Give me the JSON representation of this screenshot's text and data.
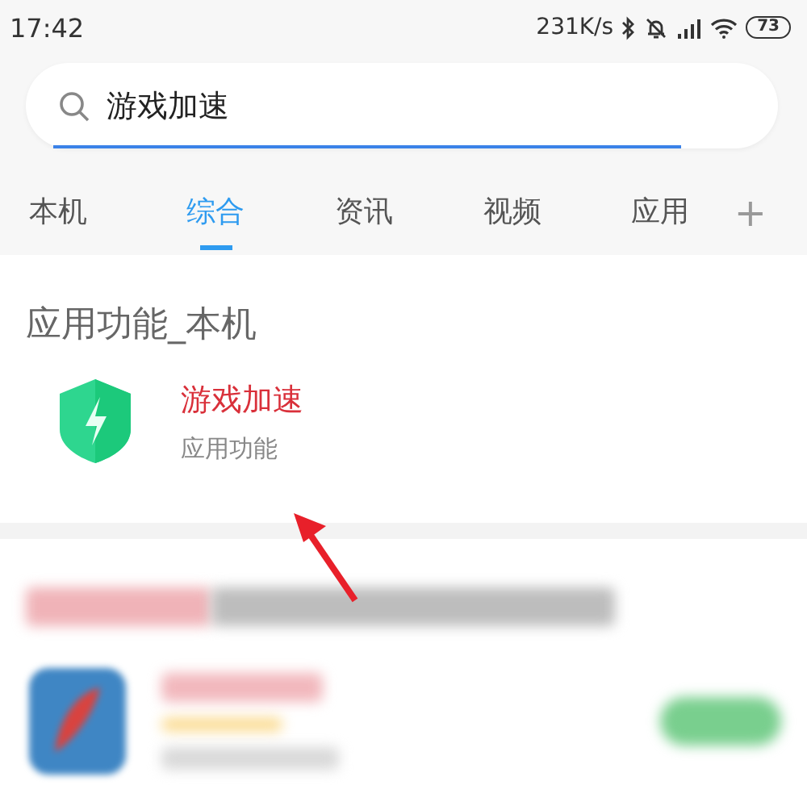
{
  "status_bar": {
    "time": "17:42",
    "network_speed": "231K/s",
    "battery": "73"
  },
  "search": {
    "value": "游戏加速"
  },
  "tabs": [
    {
      "label": "本机",
      "selected": false
    },
    {
      "label": "综合",
      "selected": true
    },
    {
      "label": "资讯",
      "selected": false
    },
    {
      "label": "视频",
      "selected": false
    },
    {
      "label": "应用",
      "selected": false
    }
  ],
  "add_tab": "+",
  "section": {
    "title": "应用功能_本机",
    "results": [
      {
        "title": "游戏加速",
        "subtitle": "应用功能"
      }
    ]
  }
}
